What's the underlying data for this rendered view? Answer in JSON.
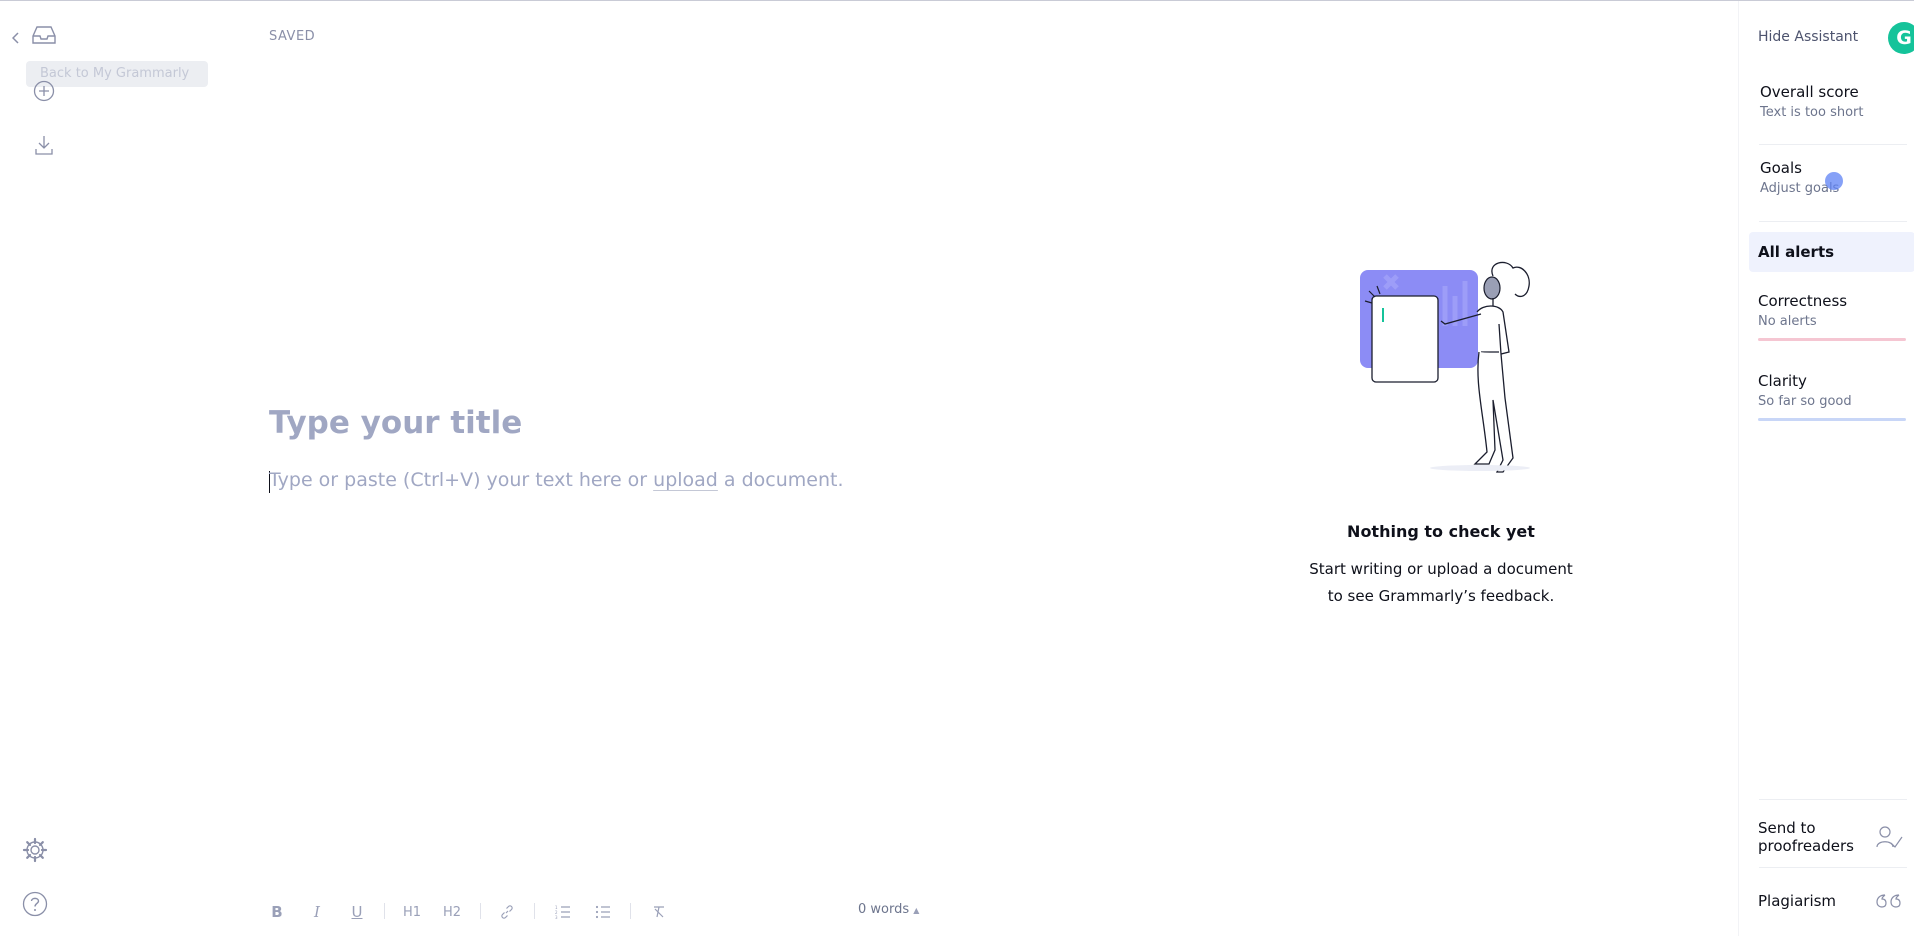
{
  "nav": {
    "tooltip": "Back to My Grammarly",
    "saved_status": "SAVED"
  },
  "editor": {
    "title_placeholder": "Type your title",
    "body_before": "Type or paste (Ctrl+V) your text here or ",
    "body_link": "upload",
    "body_after": " a document."
  },
  "empty_state": {
    "title": "Nothing to check yet",
    "line1": "Start writing or upload a document",
    "line2": "to see Grammarly’s feedback."
  },
  "assistant": {
    "hide_label": "Hide Assistant",
    "logo_letter": "G",
    "overall_score": {
      "title": "Overall score",
      "sub": "Text is too short"
    },
    "goals": {
      "title": "Goals",
      "sub": "Adjust goals"
    },
    "all_alerts": "All alerts",
    "categories": [
      {
        "title": "Correctness",
        "sub": "No alerts",
        "color": "#f5c6d2"
      },
      {
        "title": "Clarity",
        "sub": "So far so good",
        "color": "#c8d6f7"
      }
    ],
    "send_line1": "Send to",
    "send_line2": "proofreaders",
    "plagiarism": "Plagiarism"
  },
  "toolbar": {
    "bold": "B",
    "italic": "I",
    "underline": "U",
    "h1": "H1",
    "h2": "H2",
    "word_count": "0 words"
  },
  "colors": {
    "brand": "#15c39a",
    "illustration_accent": "#8c8cf5",
    "placeholder_text": "#a0a7c3"
  }
}
